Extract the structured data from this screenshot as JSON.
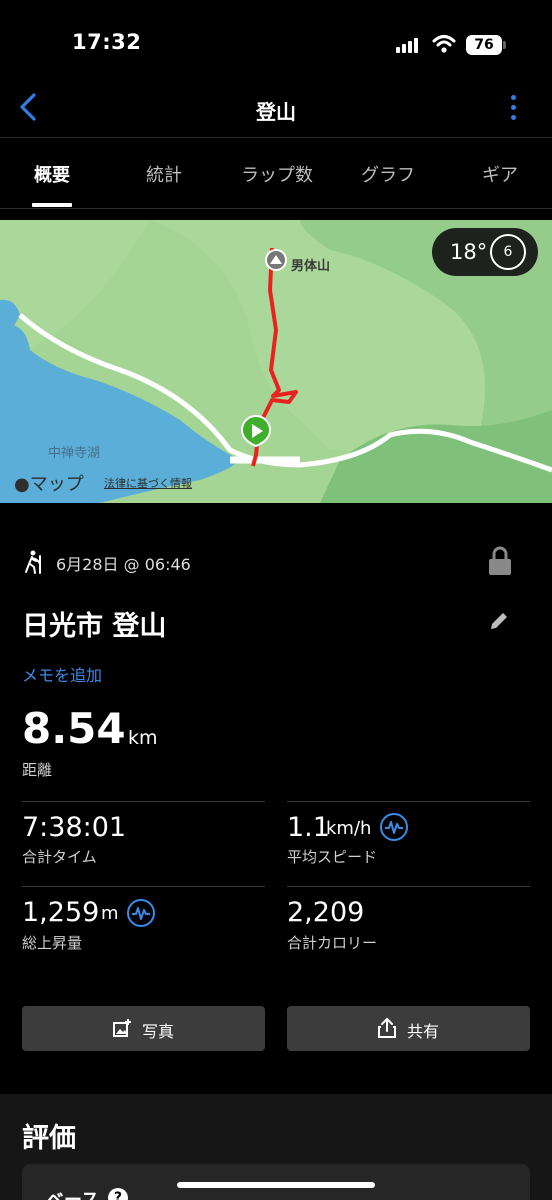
{
  "status_bar": {
    "time": "17:32",
    "battery": "76"
  },
  "nav": {
    "title": "登山"
  },
  "tabs": [
    {
      "label": "概要",
      "active": true
    },
    {
      "label": "統計",
      "active": false
    },
    {
      "label": "ラップ数",
      "active": false
    },
    {
      "label": "グラフ",
      "active": false
    },
    {
      "label": "ギア",
      "active": false
    }
  ],
  "map": {
    "temperature": "18°",
    "wind_speed": "6",
    "peak_label": "男体山",
    "lake_label": "中禅寺湖",
    "maps_brand": "マップ",
    "legal_link": "法律に基づく情報",
    "route_color": "#e8231f",
    "start_marker_color": "#3fae2a"
  },
  "activity": {
    "activity_icon": "hiking-icon",
    "date": "6月28日 @ 06:46",
    "title": "日光市 登山",
    "add_memo": "メモを追加",
    "distance_value": "8.54",
    "distance_unit": "km",
    "distance_label": "距離"
  },
  "stats": {
    "total_time": {
      "value": "7:38:01",
      "label": "合計タイム"
    },
    "avg_speed": {
      "value": "1.1",
      "unit": "km/h",
      "label": "平均スピード"
    },
    "ascent": {
      "value": "1,259",
      "unit": "m",
      "label": "総上昇量"
    },
    "calories": {
      "value": "2,209",
      "label": "合計カロリー"
    }
  },
  "actions": {
    "photo": "写真",
    "share": "共有"
  },
  "rating": {
    "title": "評価",
    "partial_label": "ベース"
  },
  "colors": {
    "accent": "#3a8be8",
    "background": "#000000"
  }
}
